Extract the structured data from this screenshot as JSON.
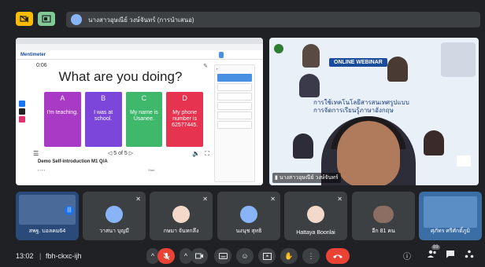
{
  "topbar": {
    "presenter_label": "นางสาวอุษณีย์ วงษ์จันทร์ (การนำเสนอ)"
  },
  "screen": {
    "site_logo": "Mentimeter",
    "timer": "0:06",
    "question": "What are you doing?",
    "cards": [
      {
        "letter": "A",
        "answer": "I'm teaching.",
        "color": "#a83ac6"
      },
      {
        "letter": "B",
        "answer": "I was at school.",
        "color": "#7b46d9"
      },
      {
        "letter": "C",
        "answer": "My name is Usanee.",
        "color": "#3fb86b"
      },
      {
        "letter": "D",
        "answer": "My phone number is 62577445.",
        "color": "#e6334f"
      }
    ],
    "pager": "5 of 5",
    "slide_title": "Demo Self-introduction M1 Q/A",
    "start_label": "Start"
  },
  "webinar": {
    "badge": "ONLINE WEBINAR",
    "title_line1": "การใช้เทคโนโลยีสารสนเทศรูปแบบ",
    "title_line2": "การจัดการเรียนรู้ภาษาอังกฤษ",
    "speaker_name": "นางสาวอุษณีย์ วงษ์จันทร์"
  },
  "participants": [
    {
      "name": "สพฐ. บอลคม64",
      "type": "screen"
    },
    {
      "name": "วาสนา บุญมี",
      "type": "avatar",
      "color": "#8ab4f8"
    },
    {
      "name": "กษมา จันทกลึง",
      "type": "photo"
    },
    {
      "name": "นงนุช สุทธิ",
      "type": "avatar",
      "color": "#8ab4f8"
    },
    {
      "name": "Hattaya Boonlai",
      "type": "photo"
    },
    {
      "name": "อีก 81 คน",
      "type": "group"
    },
    {
      "name": "ศุภัทร ศรีศักดิ์ภูมิ",
      "type": "video"
    }
  ],
  "bottom": {
    "time": "13:02",
    "separator": "|",
    "meeting_code": "fbh-ckxc-ijh",
    "people_count": "89"
  }
}
